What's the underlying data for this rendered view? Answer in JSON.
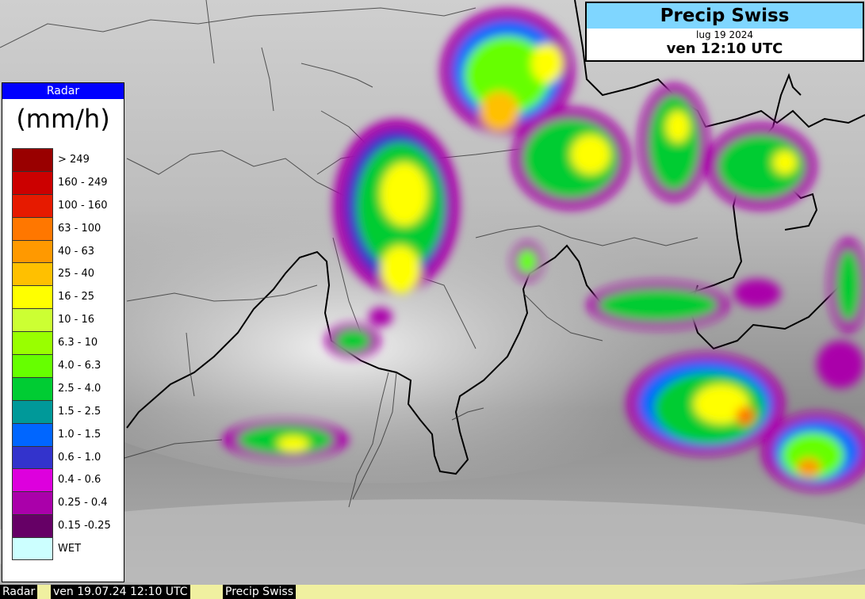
{
  "title": {
    "product": "Precip Swiss",
    "date": "lug 19 2024",
    "time": "ven 12:10 UTC"
  },
  "legend": {
    "header": "Radar",
    "unit": "(mm/h)",
    "entries": [
      {
        "label": "> 249",
        "color": "#990000"
      },
      {
        "label": "160 - 249",
        "color": "#cc0000"
      },
      {
        "label": "100 - 160",
        "color": "#e61a00"
      },
      {
        "label": "63 - 100",
        "color": "#ff7700"
      },
      {
        "label": "40 - 63",
        "color": "#ff9900"
      },
      {
        "label": "25 - 40",
        "color": "#ffc000"
      },
      {
        "label": "16 - 25",
        "color": "#ffff00"
      },
      {
        "label": "10 - 16",
        "color": "#ccff33"
      },
      {
        "label": "6.3 - 10",
        "color": "#99ff00"
      },
      {
        "label": "4.0 - 6.3",
        "color": "#66ff00"
      },
      {
        "label": "2.5 - 4.0",
        "color": "#00cc33"
      },
      {
        "label": "1.5 - 2.5",
        "color": "#009999"
      },
      {
        "label": "1.0 - 1.5",
        "color": "#0066ff"
      },
      {
        "label": "0.6 - 1.0",
        "color": "#3333cc"
      },
      {
        "label": "0.4 - 0.6",
        "color": "#dd00dd"
      },
      {
        "label": "0.25 - 0.4",
        "color": "#aa00aa"
      },
      {
        "label": "0.15 -0.25",
        "color": "#660066"
      },
      {
        "label": "WET",
        "color": "#ccffff"
      }
    ]
  },
  "footer": {
    "source": "Radar",
    "datetime": "ven 19.07.24 12:10 UTC",
    "product": "Precip Swiss"
  }
}
